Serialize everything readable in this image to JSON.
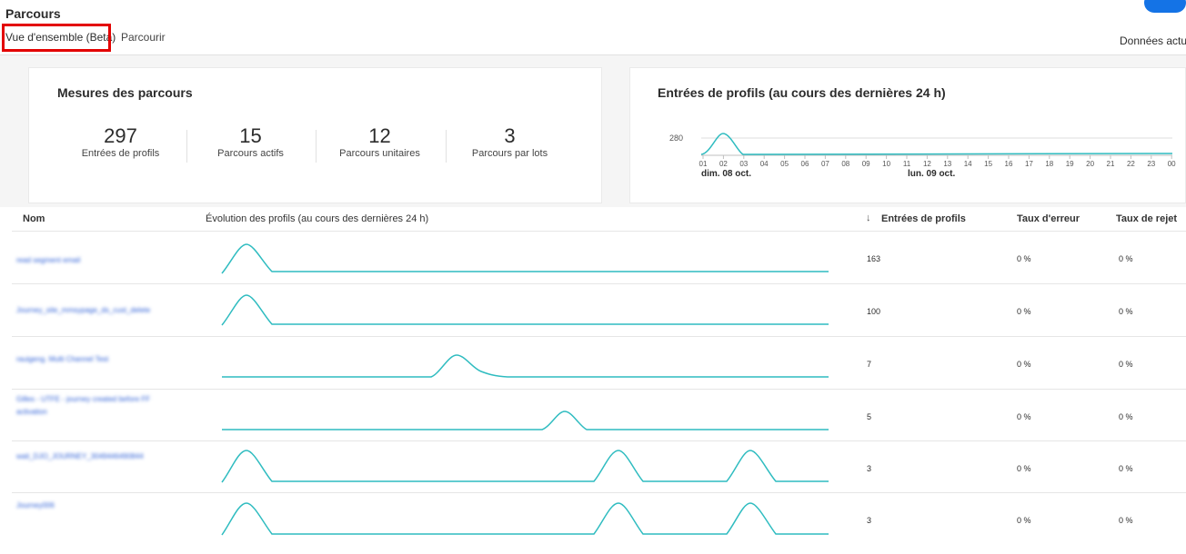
{
  "header": {
    "title": "Parcours",
    "tabs": [
      {
        "label": "Vue d'ensemble (Beta)",
        "active": true
      },
      {
        "label": "Parcourir",
        "active": false
      }
    ],
    "last_update": "Données actua"
  },
  "metrics_card": {
    "title": "Mesures des parcours",
    "metrics": [
      {
        "value": "297",
        "label": "Entrées de profils"
      },
      {
        "value": "15",
        "label": "Parcours actifs"
      },
      {
        "value": "12",
        "label": "Parcours unitaires"
      },
      {
        "value": "3",
        "label": "Parcours par lots"
      }
    ]
  },
  "entries_card": {
    "title": "Entrées de profils (au cours des dernières 24 h)",
    "y_tick": "280",
    "hours": [
      "01",
      "02",
      "03",
      "04",
      "05",
      "06",
      "07",
      "08",
      "09",
      "10",
      "11",
      "12",
      "13",
      "14",
      "15",
      "16",
      "17",
      "18",
      "19",
      "20",
      "21",
      "22",
      "23",
      "00"
    ],
    "day_labels": [
      "dim. 08 oct.",
      "lun. 09 oct."
    ]
  },
  "table": {
    "columns": {
      "name": "Nom",
      "evolution": "Évolution des profils (au cours des dernières 24 h)",
      "entries": "Entrées de profils",
      "error_rate": "Taux d'erreur",
      "reject_rate": "Taux de rejet"
    },
    "rows": [
      {
        "name": "read segment email",
        "entries": "163",
        "error": "0 %",
        "reject": "0 %"
      },
      {
        "name": "Journey_site_mmsypage_ds_cust_delete",
        "entries": "100",
        "error": "0 %",
        "reject": "0 %"
      },
      {
        "name": "rauigeng. Multi Channel Test",
        "entries": "7",
        "error": "0 %",
        "reject": "0 %"
      },
      {
        "name": "Gilles - UTFE - journey created before FF activation",
        "entries": "5",
        "error": "0 %",
        "reject": "0 %"
      },
      {
        "name": "wait_DJO_JOURNEY_3049446490844",
        "entries": "3",
        "error": "0 %",
        "reject": "0 %"
      },
      {
        "name": "Journey006",
        "entries": "3",
        "error": "0 %",
        "reject": "0 %"
      }
    ]
  },
  "colors": {
    "sparkline": "#2fbcc0",
    "accent": "#1473e6",
    "highlight_box": "#e30000"
  }
}
